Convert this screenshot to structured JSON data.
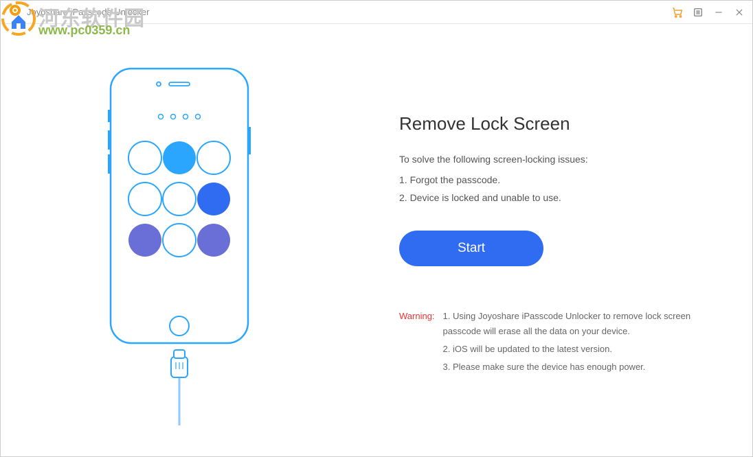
{
  "titlebar": {
    "app_title": "Joyoshare iPasscode Unlocker"
  },
  "main": {
    "heading": "Remove Lock Screen",
    "subheading": "To solve the following screen-locking issues:",
    "issues": [
      "1. Forgot the passcode.",
      "2. Device is locked and unable to use."
    ],
    "start_label": "Start"
  },
  "warning": {
    "label": "Warning:",
    "items": [
      "1. Using Joyoshare iPasscode Unlocker to remove lock screen passcode will erase all the data on your device.",
      "2. iOS will be updated to the latest version.",
      "3. Please make sure the device has enough power."
    ]
  },
  "watermark": {
    "line1": "河东软件园",
    "line2": "www.pc0359.cn"
  },
  "colors": {
    "accent": "#2f6cf1",
    "warning": "#e33",
    "phone_stroke": "#2aa6ff",
    "dot_fill_blue": "#2f6cf1",
    "dot_fill_purple": "#6a6fd8"
  }
}
